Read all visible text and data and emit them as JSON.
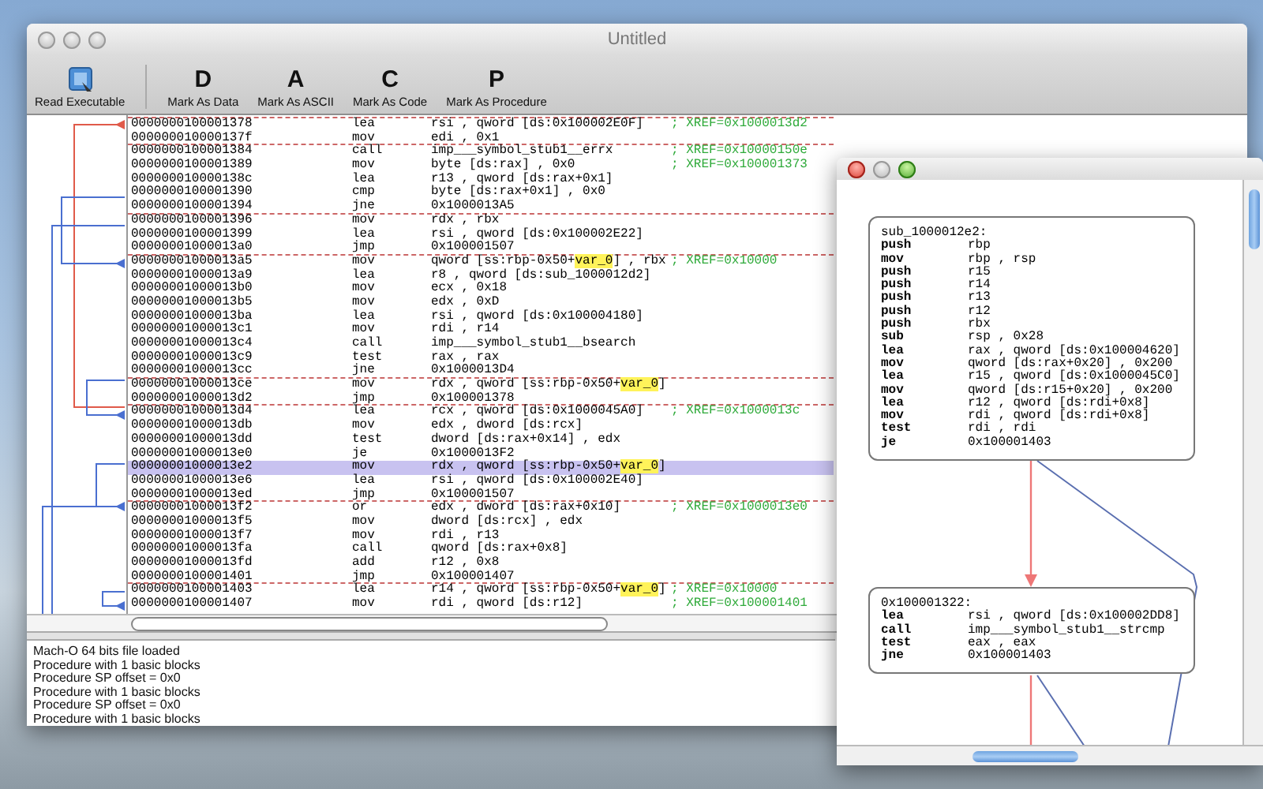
{
  "main_window": {
    "title": "Untitled",
    "active": false,
    "toolbar": {
      "read_button": {
        "label": "Read Executable"
      },
      "mark_buttons": [
        {
          "glyph": "D",
          "label": "Mark As Data"
        },
        {
          "glyph": "A",
          "label": "Mark As ASCII"
        },
        {
          "glyph": "C",
          "label": "Mark As Code"
        },
        {
          "glyph": "P",
          "label": "Mark As Procedure"
        }
      ]
    },
    "listing": [
      {
        "address": "0000000100001378",
        "mnemonic": "lea",
        "operands": [
          {
            "text": "rsi , qword [ds:0x100002E0F]",
            "highlight": false
          }
        ],
        "comment": "; XREF=0x1000013d2",
        "block_start": true,
        "selected": false
      },
      {
        "address": "000000010000137f",
        "mnemonic": "mov",
        "operands": [
          {
            "text": "edi , 0x1",
            "highlight": false
          }
        ],
        "block_start": false,
        "selected": false
      },
      {
        "address": "0000000100001384",
        "mnemonic": "call",
        "operands": [
          {
            "text": "imp___symbol_stub1__errx",
            "highlight": false
          }
        ],
        "comment": "; XREF=0x10000150e",
        "block_start": true,
        "selected": false
      },
      {
        "address": "0000000100001389",
        "mnemonic": "mov",
        "operands": [
          {
            "text": "byte [ds:rax] , 0x0",
            "highlight": false
          }
        ],
        "comment": "; XREF=0x100001373",
        "block_start": false,
        "selected": false
      },
      {
        "address": "000000010000138c",
        "mnemonic": "lea",
        "operands": [
          {
            "text": "r13 , qword [ds:rax+0x1]",
            "highlight": false
          }
        ],
        "block_start": false,
        "selected": false
      },
      {
        "address": "0000000100001390",
        "mnemonic": "cmp",
        "operands": [
          {
            "text": "byte [ds:rax+0x1] , 0x0",
            "highlight": false
          }
        ],
        "block_start": false,
        "selected": false
      },
      {
        "address": "0000000100001394",
        "mnemonic": "jne",
        "operands": [
          {
            "text": "0x1000013A5",
            "highlight": false
          }
        ],
        "block_start": false,
        "selected": false
      },
      {
        "address": "0000000100001396",
        "mnemonic": "mov",
        "operands": [
          {
            "text": "rdx , rbx",
            "highlight": false
          }
        ],
        "block_start": true,
        "selected": false
      },
      {
        "address": "0000000100001399",
        "mnemonic": "lea",
        "operands": [
          {
            "text": "rsi , qword [ds:0x100002E22]",
            "highlight": false
          }
        ],
        "block_start": false,
        "selected": false
      },
      {
        "address": "00000001000013a0",
        "mnemonic": "jmp",
        "operands": [
          {
            "text": "0x100001507",
            "highlight": false
          }
        ],
        "block_start": false,
        "selected": false
      },
      {
        "address": "00000001000013a5",
        "mnemonic": "mov",
        "operands": [
          {
            "text": "qword [ss:rbp-0x50+",
            "highlight": false
          },
          {
            "text": "var_0",
            "highlight": true
          },
          {
            "text": "] , rbx",
            "highlight": false
          }
        ],
        "comment": "; XREF=0x10000",
        "block_start": true,
        "selected": false
      },
      {
        "address": "00000001000013a9",
        "mnemonic": "lea",
        "operands": [
          {
            "text": "r8 , qword [ds:sub_1000012d2]",
            "highlight": false
          }
        ],
        "block_start": false,
        "selected": false
      },
      {
        "address": "00000001000013b0",
        "mnemonic": "mov",
        "operands": [
          {
            "text": "ecx , 0x18",
            "highlight": false
          }
        ],
        "block_start": false,
        "selected": false
      },
      {
        "address": "00000001000013b5",
        "mnemonic": "mov",
        "operands": [
          {
            "text": "edx , 0xD",
            "highlight": false
          }
        ],
        "block_start": false,
        "selected": false
      },
      {
        "address": "00000001000013ba",
        "mnemonic": "lea",
        "operands": [
          {
            "text": "rsi , qword [ds:0x100004180]",
            "highlight": false
          }
        ],
        "block_start": false,
        "selected": false
      },
      {
        "address": "00000001000013c1",
        "mnemonic": "mov",
        "operands": [
          {
            "text": "rdi , r14",
            "highlight": false
          }
        ],
        "block_start": false,
        "selected": false
      },
      {
        "address": "00000001000013c4",
        "mnemonic": "call",
        "operands": [
          {
            "text": "imp___symbol_stub1__bsearch",
            "highlight": false
          }
        ],
        "block_start": false,
        "selected": false
      },
      {
        "address": "00000001000013c9",
        "mnemonic": "test",
        "operands": [
          {
            "text": "rax , rax",
            "highlight": false
          }
        ],
        "block_start": false,
        "selected": false
      },
      {
        "address": "00000001000013cc",
        "mnemonic": "jne",
        "operands": [
          {
            "text": "0x1000013D4",
            "highlight": false
          }
        ],
        "block_start": false,
        "selected": false
      },
      {
        "address": "00000001000013ce",
        "mnemonic": "mov",
        "operands": [
          {
            "text": "rdx , qword [ss:rbp-0x50+",
            "highlight": false
          },
          {
            "text": "var_0",
            "highlight": true
          },
          {
            "text": "]",
            "highlight": false
          }
        ],
        "block_start": true,
        "selected": false
      },
      {
        "address": "00000001000013d2",
        "mnemonic": "jmp",
        "operands": [
          {
            "text": "0x100001378",
            "highlight": false
          }
        ],
        "block_start": false,
        "selected": false
      },
      {
        "address": "00000001000013d4",
        "mnemonic": "lea",
        "operands": [
          {
            "text": "rcx , qword [ds:0x1000045A0]",
            "highlight": false
          }
        ],
        "comment": "; XREF=0x1000013c",
        "block_start": true,
        "selected": false
      },
      {
        "address": "00000001000013db",
        "mnemonic": "mov",
        "operands": [
          {
            "text": "edx , dword [ds:rcx]",
            "highlight": false
          }
        ],
        "block_start": false,
        "selected": false
      },
      {
        "address": "00000001000013dd",
        "mnemonic": "test",
        "operands": [
          {
            "text": "dword [ds:rax+0x14] , edx",
            "highlight": false
          }
        ],
        "block_start": false,
        "selected": false
      },
      {
        "address": "00000001000013e0",
        "mnemonic": "je",
        "operands": [
          {
            "text": "0x1000013F2",
            "highlight": false
          }
        ],
        "block_start": false,
        "selected": false
      },
      {
        "address": "00000001000013e2",
        "mnemonic": "mov",
        "operands": [
          {
            "text": "rdx , qword [ss:rbp-0x50+",
            "highlight": false
          },
          {
            "text": "var_0",
            "highlight": true
          },
          {
            "text": "]",
            "highlight": false
          }
        ],
        "block_start": false,
        "selected": true
      },
      {
        "address": "00000001000013e6",
        "mnemonic": "lea",
        "operands": [
          {
            "text": "rsi , qword [ds:0x100002E40]",
            "highlight": false
          }
        ],
        "block_start": false,
        "selected": false
      },
      {
        "address": "00000001000013ed",
        "mnemonic": "jmp",
        "operands": [
          {
            "text": "0x100001507",
            "highlight": false
          }
        ],
        "block_start": false,
        "selected": false
      },
      {
        "address": "00000001000013f2",
        "mnemonic": "or",
        "operands": [
          {
            "text": "edx , dword [ds:rax+0x10]",
            "highlight": false
          }
        ],
        "comment": "; XREF=0x1000013e0",
        "block_start": true,
        "selected": false
      },
      {
        "address": "00000001000013f5",
        "mnemonic": "mov",
        "operands": [
          {
            "text": "dword [ds:rcx] , edx",
            "highlight": false
          }
        ],
        "block_start": false,
        "selected": false
      },
      {
        "address": "00000001000013f7",
        "mnemonic": "mov",
        "operands": [
          {
            "text": "rdi , r13",
            "highlight": false
          }
        ],
        "block_start": false,
        "selected": false
      },
      {
        "address": "00000001000013fa",
        "mnemonic": "call",
        "operands": [
          {
            "text": "qword [ds:rax+0x8]",
            "highlight": false
          }
        ],
        "block_start": false,
        "selected": false
      },
      {
        "address": "00000001000013fd",
        "mnemonic": "add",
        "operands": [
          {
            "text": "r12 , 0x8",
            "highlight": false
          }
        ],
        "block_start": false,
        "selected": false
      },
      {
        "address": "0000000100001401",
        "mnemonic": "jmp",
        "operands": [
          {
            "text": "0x100001407",
            "highlight": false
          }
        ],
        "block_start": false,
        "selected": false
      },
      {
        "address": "0000000100001403",
        "mnemonic": "lea",
        "operands": [
          {
            "text": "r14 , qword [ss:rbp-0x50+",
            "highlight": false
          },
          {
            "text": "var_0",
            "highlight": true
          },
          {
            "text": "]",
            "highlight": false
          }
        ],
        "comment": "; XREF=0x10000",
        "block_start": true,
        "selected": false
      },
      {
        "address": "0000000100001407",
        "mnemonic": "mov",
        "operands": [
          {
            "text": "rdi , qword [ds:r12]",
            "highlight": false
          }
        ],
        "comment": "; XREF=0x100001401",
        "block_start": false,
        "selected": false
      }
    ],
    "log": [
      "Mach-O 64 bits file loaded",
      "Procedure with 1 basic blocks",
      "Procedure SP offset = 0x0",
      "Procedure with 1 basic blocks",
      "Procedure SP offset = 0x0",
      "Procedure with 1 basic blocks"
    ]
  },
  "graph_window": {
    "active": true,
    "minimize_enabled": false,
    "nodes": [
      {
        "label": "sub_1000012e2:",
        "instructions": [
          {
            "mnemonic": "push",
            "operands": "rbp"
          },
          {
            "mnemonic": "mov",
            "operands": "rbp , rsp"
          },
          {
            "mnemonic": "push",
            "operands": "r15"
          },
          {
            "mnemonic": "push",
            "operands": "r14"
          },
          {
            "mnemonic": "push",
            "operands": "r13"
          },
          {
            "mnemonic": "push",
            "operands": "r12"
          },
          {
            "mnemonic": "push",
            "operands": "rbx"
          },
          {
            "mnemonic": "sub",
            "operands": "rsp , 0x28"
          },
          {
            "mnemonic": "lea",
            "operands": "rax , qword [ds:0x100004620]"
          },
          {
            "mnemonic": "mov",
            "operands": "qword [ds:rax+0x20] , 0x200"
          },
          {
            "mnemonic": "lea",
            "operands": "r15 , qword [ds:0x1000045C0]"
          },
          {
            "mnemonic": "mov",
            "operands": "qword [ds:r15+0x20] , 0x200"
          },
          {
            "mnemonic": "lea",
            "operands": "r12 , qword [ds:rdi+0x8]"
          },
          {
            "mnemonic": "mov",
            "operands": "rdi , qword [ds:rdi+0x8]"
          },
          {
            "mnemonic": "test",
            "operands": "rdi , rdi"
          },
          {
            "mnemonic": "je",
            "operands": "0x100001403"
          }
        ]
      },
      {
        "label": "0x100001322:",
        "instructions": [
          {
            "mnemonic": "lea",
            "operands": "rsi , qword [ds:0x100002DD8]"
          },
          {
            "mnemonic": "call",
            "operands": "imp___symbol_stub1__strcmp"
          },
          {
            "mnemonic": "test",
            "operands": "eax , eax"
          },
          {
            "mnemonic": "jne",
            "operands": "0x100001403"
          }
        ]
      }
    ]
  }
}
